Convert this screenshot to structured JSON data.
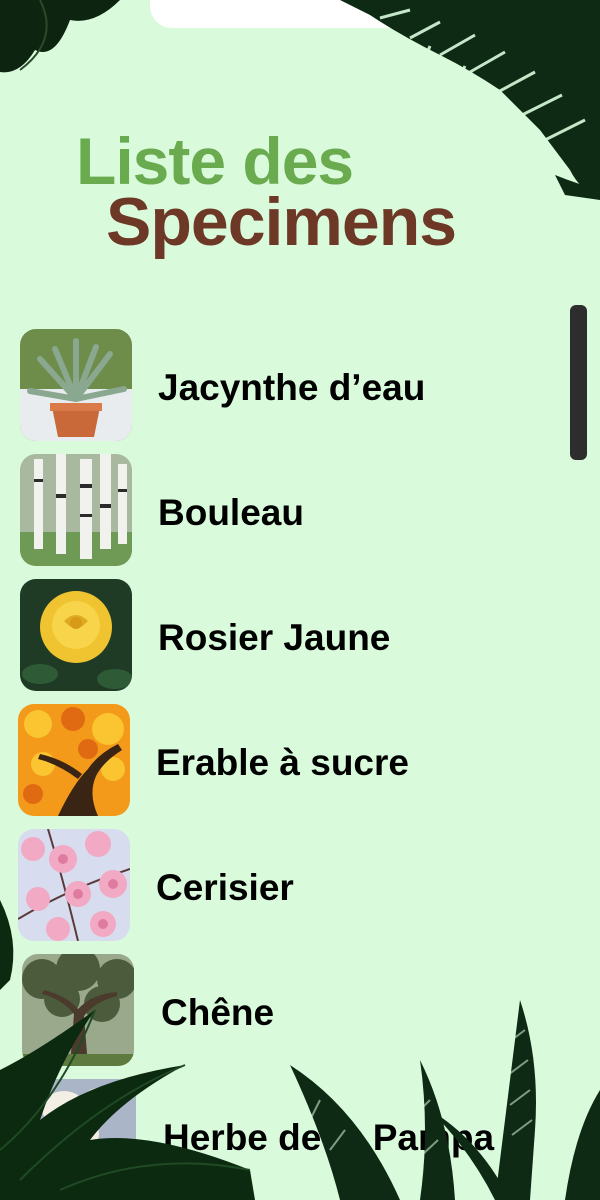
{
  "header": {
    "title_line1": "Liste des",
    "title_line2": "Specimens"
  },
  "specimens": [
    {
      "name": "Jacynthe d’eau",
      "icon": "agave-potted-plant-photo"
    },
    {
      "name": "Bouleau",
      "icon": "birch-trees-photo"
    },
    {
      "name": "Rosier Jaune",
      "icon": "yellow-rose-photo"
    },
    {
      "name": "Erable à sucre",
      "icon": "autumn-maple-photo"
    },
    {
      "name": "Cerisier",
      "icon": "cherry-blossom-photo"
    },
    {
      "name": "Chêne",
      "icon": "oak-tree-photo"
    },
    {
      "name": "Herbe de la Pampa",
      "icon": "pampas-grass-photo"
    }
  ],
  "colors": {
    "background": "#d9fbdc",
    "title_green": "#6aab50",
    "title_brown": "#6d3826",
    "foliage": "#0f2a14"
  }
}
